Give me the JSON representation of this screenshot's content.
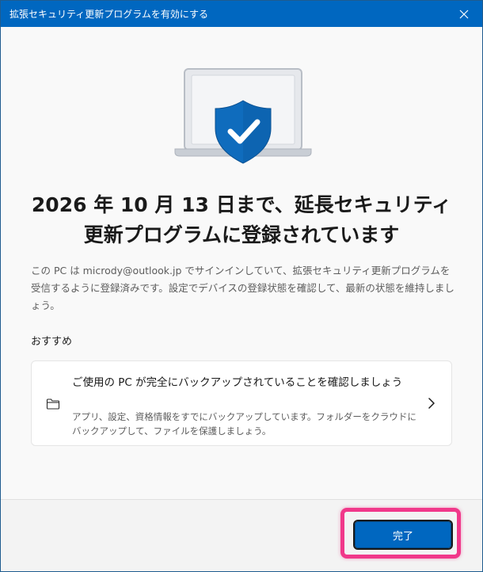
{
  "window": {
    "title": "拡張セキュリティ更新プログラムを有効にする"
  },
  "main": {
    "heading": "2026 年 10 月 13 日まで、延長セキュリティ更新プログラムに登録されています",
    "description": "この PC は micrody@outlook.jp でサインインしていて、拡張セキュリティ更新プログラムを受信するように登録済みです。設定でデバイスの登録状態を確認して、最新の状態を維持しましょう。",
    "section_label": "おすすめ",
    "recommendation": {
      "title": "ご使用の PC が完全にバックアップされていることを確認しましょう",
      "description": "アプリ、設定、資格情報をすでにバックアップしています。フォルダーをクラウドにバックアップして、ファイルを保護しましょう。",
      "icon": "folder-icon"
    }
  },
  "footer": {
    "done_label": "完了"
  },
  "colors": {
    "accent": "#0067c0",
    "highlight": "#f0388a",
    "shield": "#0f6cbd"
  },
  "icons": [
    "close-icon",
    "laptop-icon",
    "shield-check-icon",
    "folder-icon",
    "chevron-right-icon"
  ]
}
